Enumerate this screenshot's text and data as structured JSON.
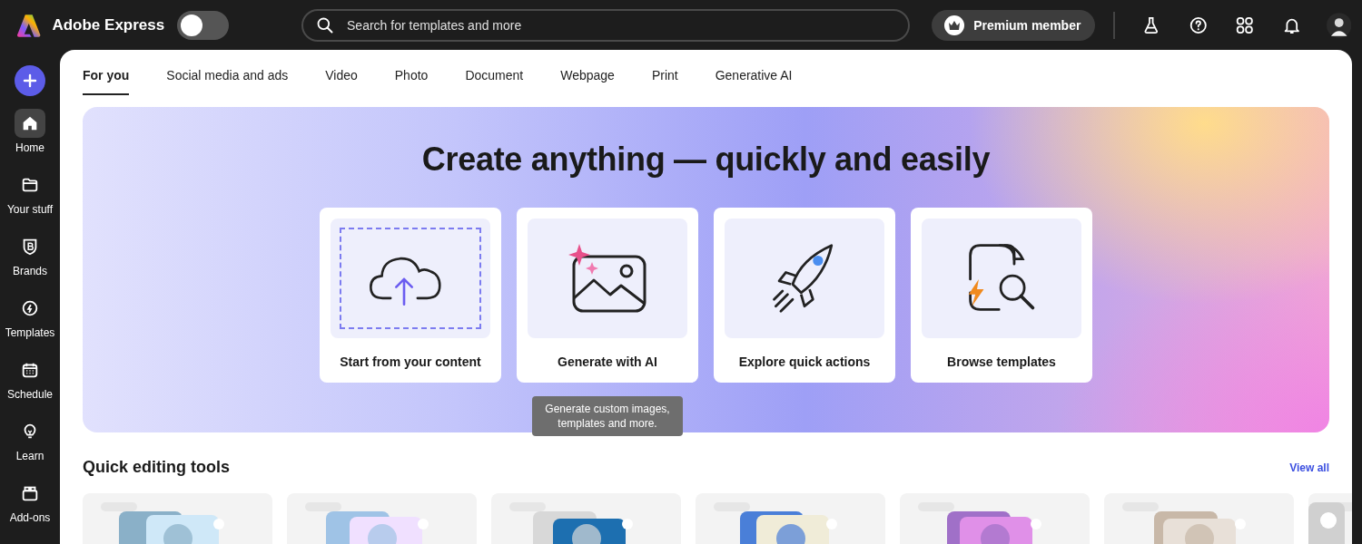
{
  "app": {
    "name": "Adobe Express"
  },
  "mode_toggle": {
    "on": false
  },
  "search": {
    "placeholder": "Search for templates and more"
  },
  "premium": {
    "label": "Premium member"
  },
  "header_icons": [
    {
      "kind": "flask"
    },
    {
      "kind": "help"
    },
    {
      "kind": "apps"
    },
    {
      "kind": "bell"
    },
    {
      "kind": "avatar"
    }
  ],
  "sidebar": {
    "items": [
      {
        "label": "Home",
        "kind": "home",
        "selected": true
      },
      {
        "label": "Your stuff",
        "kind": "folder",
        "selected": false
      },
      {
        "label": "Brands",
        "kind": "brand",
        "selected": false
      },
      {
        "label": "Templates",
        "kind": "templates",
        "selected": false
      },
      {
        "label": "Schedule",
        "kind": "calendar",
        "selected": false
      },
      {
        "label": "Learn",
        "kind": "bulb",
        "selected": false
      },
      {
        "label": "Add-ons",
        "kind": "addons",
        "selected": false
      }
    ]
  },
  "tabs": [
    {
      "label": "For you",
      "selected": true
    },
    {
      "label": "Social media and ads",
      "selected": false
    },
    {
      "label": "Video",
      "selected": false
    },
    {
      "label": "Photo",
      "selected": false
    },
    {
      "label": "Document",
      "selected": false
    },
    {
      "label": "Webpage",
      "selected": false
    },
    {
      "label": "Print",
      "selected": false
    },
    {
      "label": "Generative AI",
      "selected": false
    }
  ],
  "hero": {
    "title": "Create anything — quickly and easily",
    "cards": [
      {
        "label": "Start from your content",
        "kind": "upload"
      },
      {
        "label": "Generate with AI",
        "kind": "generate",
        "tooltip": "Generate custom images, templates and more."
      },
      {
        "label": "Explore quick actions",
        "kind": "rocket"
      },
      {
        "label": "Browse templates",
        "kind": "browse"
      }
    ]
  },
  "quick_tools": {
    "title": "Quick editing tools",
    "link": "View all"
  }
}
